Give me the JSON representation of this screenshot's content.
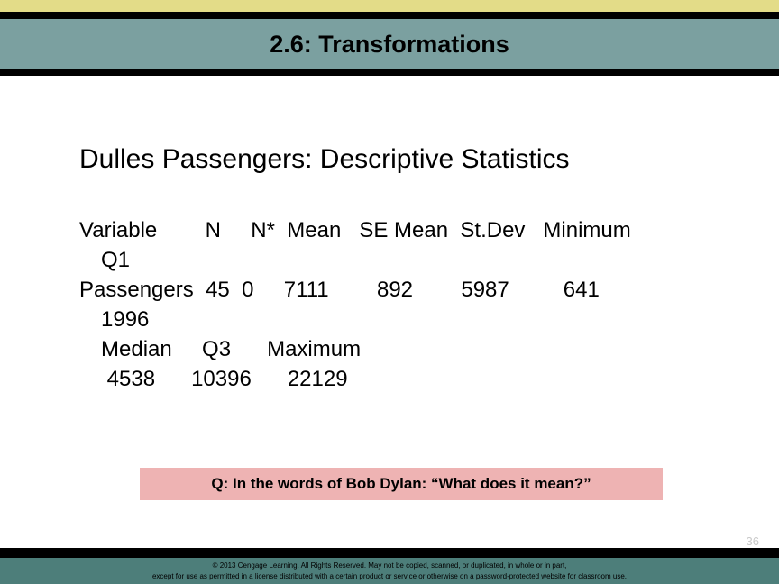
{
  "slide": {
    "title": "2.6: Transformations",
    "heading": "Dulles Passengers: Descriptive Statistics",
    "page_number": "36"
  },
  "colors": {
    "accent_yellow": "#e3dc88",
    "title_bar_teal": "#7ba0a0",
    "footer_teal": "#4d7e7a",
    "callout_pink": "#eeb3b3",
    "rule_black": "#000000",
    "page_number_gray": "#c9c9c9"
  },
  "stats_output": {
    "header_line_1": "Variable        N     N*  Mean   SE Mean  St.Dev   Minimum",
    "header_line_2": "Q1",
    "data_line_1": "Passengers  45  0     7111        892        5987         641",
    "data_line_2": "1996",
    "header_line_3": "Median     Q3      Maximum",
    "data_line_3": " 4538      10396      22129",
    "columns": [
      "Variable",
      "N",
      "N*",
      "Mean",
      "SE Mean",
      "St.Dev",
      "Minimum",
      "Q1",
      "Median",
      "Q3",
      "Maximum"
    ],
    "values": {
      "Variable": "Passengers",
      "N": "45",
      "N*": "0",
      "Mean": "7111",
      "SE Mean": "892",
      "St.Dev": "5987",
      "Minimum": "641",
      "Q1": "1996",
      "Median": "4538",
      "Q3": "10396",
      "Maximum": "22129"
    }
  },
  "callout": {
    "text": "Q: In the words of Bob Dylan: “What does it mean?”"
  },
  "footer": {
    "line_1": "© 2013 Cengage Learning. All Rights Reserved. May not be copied, scanned, or duplicated, in whole or in part,",
    "line_2": "except for use as permitted in a license distributed with a certain product or service or otherwise on a password-protected website for classroom use."
  }
}
